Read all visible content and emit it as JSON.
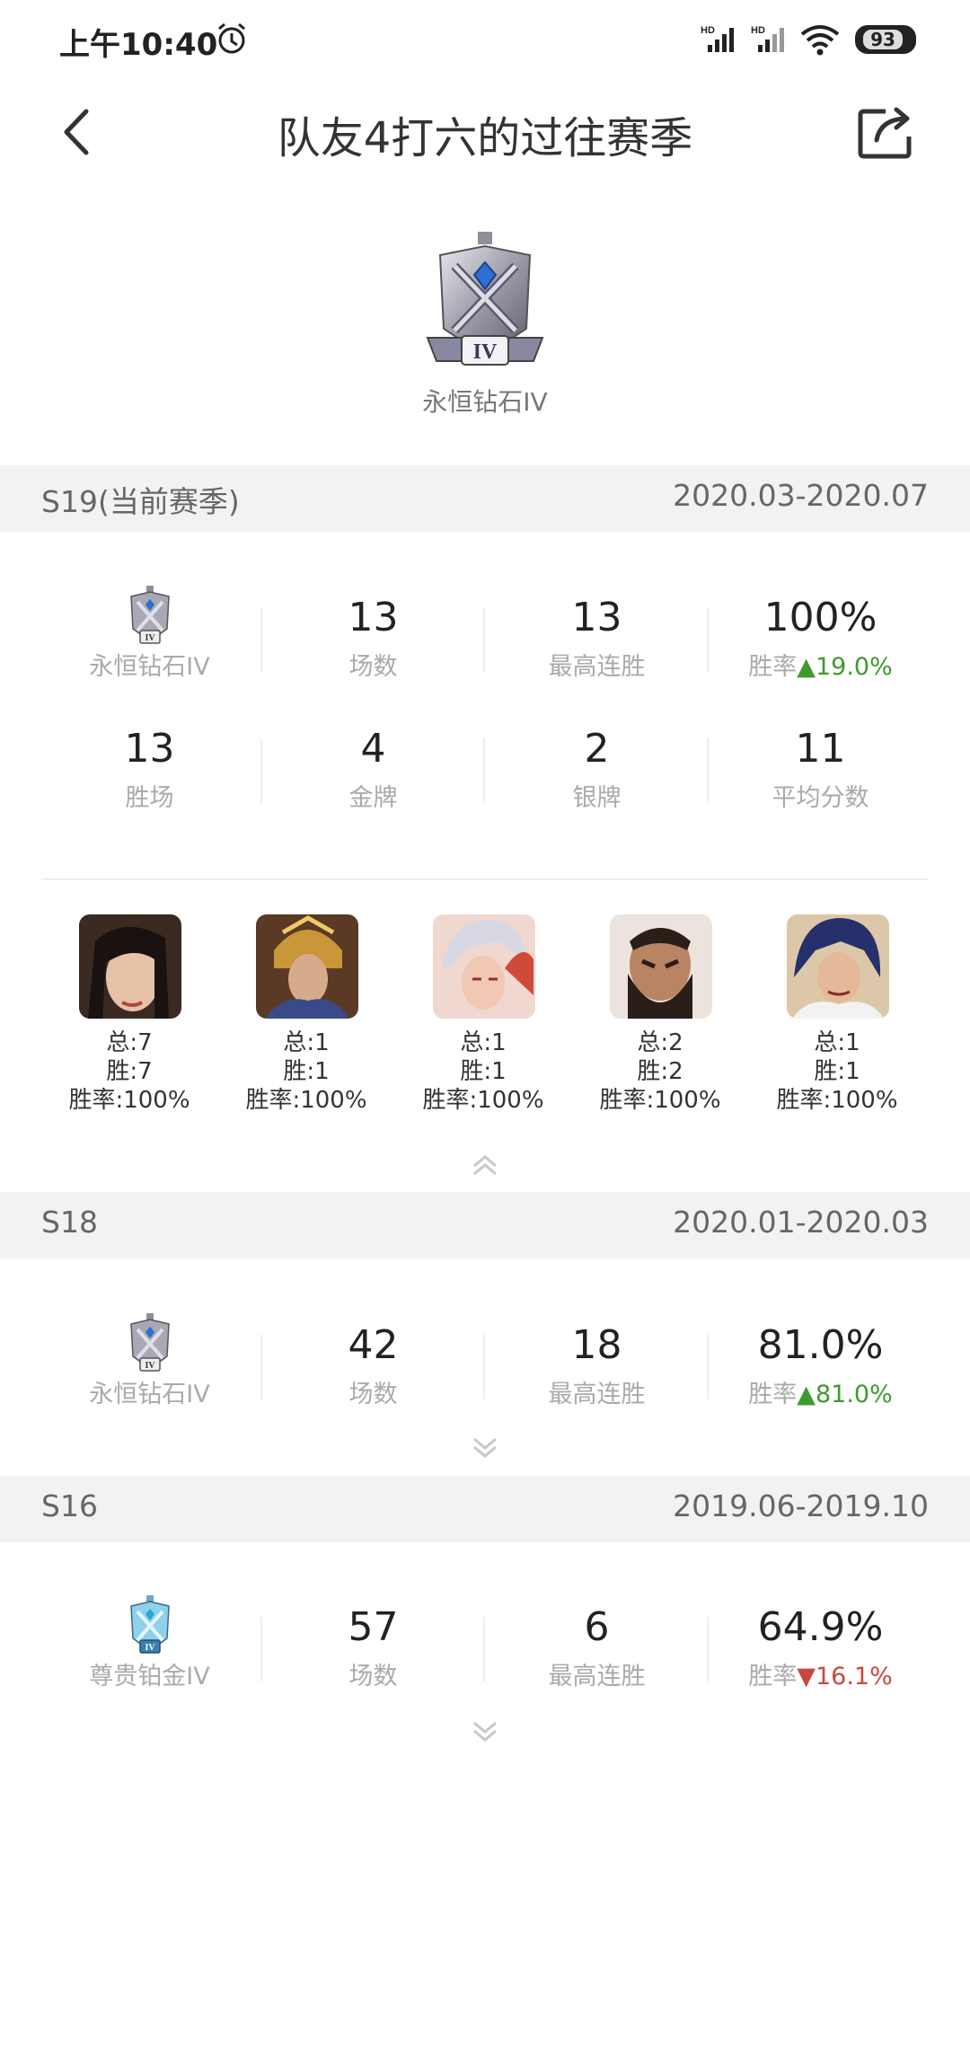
{
  "status_bar": {
    "time": "上午10:40",
    "battery": "93"
  },
  "nav": {
    "title": "队友4打六的过往赛季"
  },
  "top_rank": {
    "label": "永恒钻石IV"
  },
  "seasons": [
    {
      "name": "S19(当前赛季)",
      "range": "2020.03-2020.07",
      "rank": "永恒钻石IV",
      "games": "13",
      "games_label": "场数",
      "streak": "13",
      "streak_label": "最高连胜",
      "winrate": "100%",
      "winrate_label": "胜率",
      "winrate_delta": "19.0%",
      "delta_dir": "up",
      "wins": "13",
      "wins_label": "胜场",
      "gold": "4",
      "gold_label": "金牌",
      "silver": "2",
      "silver_label": "银牌",
      "avg": "11",
      "avg_label": "平均分数",
      "heroes": [
        {
          "total": "总:7",
          "win": "胜:7",
          "rate": "胜率:100%"
        },
        {
          "total": "总:1",
          "win": "胜:1",
          "rate": "胜率:100%"
        },
        {
          "total": "总:1",
          "win": "胜:1",
          "rate": "胜率:100%"
        },
        {
          "total": "总:2",
          "win": "胜:2",
          "rate": "胜率:100%"
        },
        {
          "total": "总:1",
          "win": "胜:1",
          "rate": "胜率:100%"
        }
      ]
    },
    {
      "name": "S18",
      "range": "2020.01-2020.03",
      "rank": "永恒钻石IV",
      "games": "42",
      "games_label": "场数",
      "streak": "18",
      "streak_label": "最高连胜",
      "winrate": "81.0%",
      "winrate_label": "胜率",
      "winrate_delta": "81.0%",
      "delta_dir": "up"
    },
    {
      "name": "S16",
      "range": "2019.06-2019.10",
      "rank": "尊贵铂金IV",
      "games": "57",
      "games_label": "场数",
      "streak": "6",
      "streak_label": "最高连胜",
      "winrate": "64.9%",
      "winrate_label": "胜率",
      "winrate_delta": "16.1%",
      "delta_dir": "down"
    }
  ],
  "colors": {
    "up": "#3f9a2e",
    "down": "#c9483d",
    "section_bg": "#f2f2f0"
  },
  "icons": [
    "alarm-icon",
    "signal-icon",
    "wifi-icon",
    "back-icon",
    "share-icon",
    "rank-badge-icon",
    "chevron-up-icon",
    "chevron-down-icon"
  ]
}
